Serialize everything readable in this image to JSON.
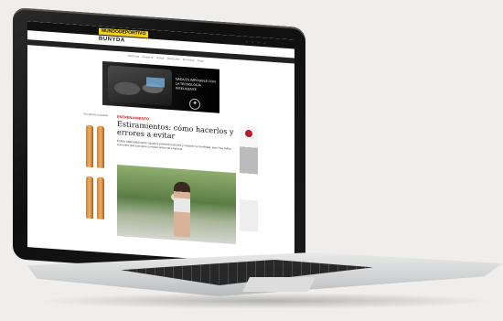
{
  "site": {
    "badge": "MUNDODEPORTIVO",
    "name": "BUNYDA",
    "nav": "Noticias · Deporte · Salud · Nutrición · Running · Yoga",
    "top_icons": "◦ ◦ ◦ ◦"
  },
  "ad": {
    "text": "NADA ES IMPOSIBLE CON LA TECNOLOGÍA INTELIGENTE",
    "logo": "✦"
  },
  "article": {
    "kicker": "ENTRENAMIENTO",
    "headline": "Estiramientos: cómo hacerlos y errores a evitar",
    "summary": "Estirar adecuadamente ayuda a prevenir lesiones y mejorar la movilidad, pero hay fallos comunes que conviene conocer antes de empezar."
  },
  "side_left": {
    "header": "Encuentra tu pasión"
  }
}
